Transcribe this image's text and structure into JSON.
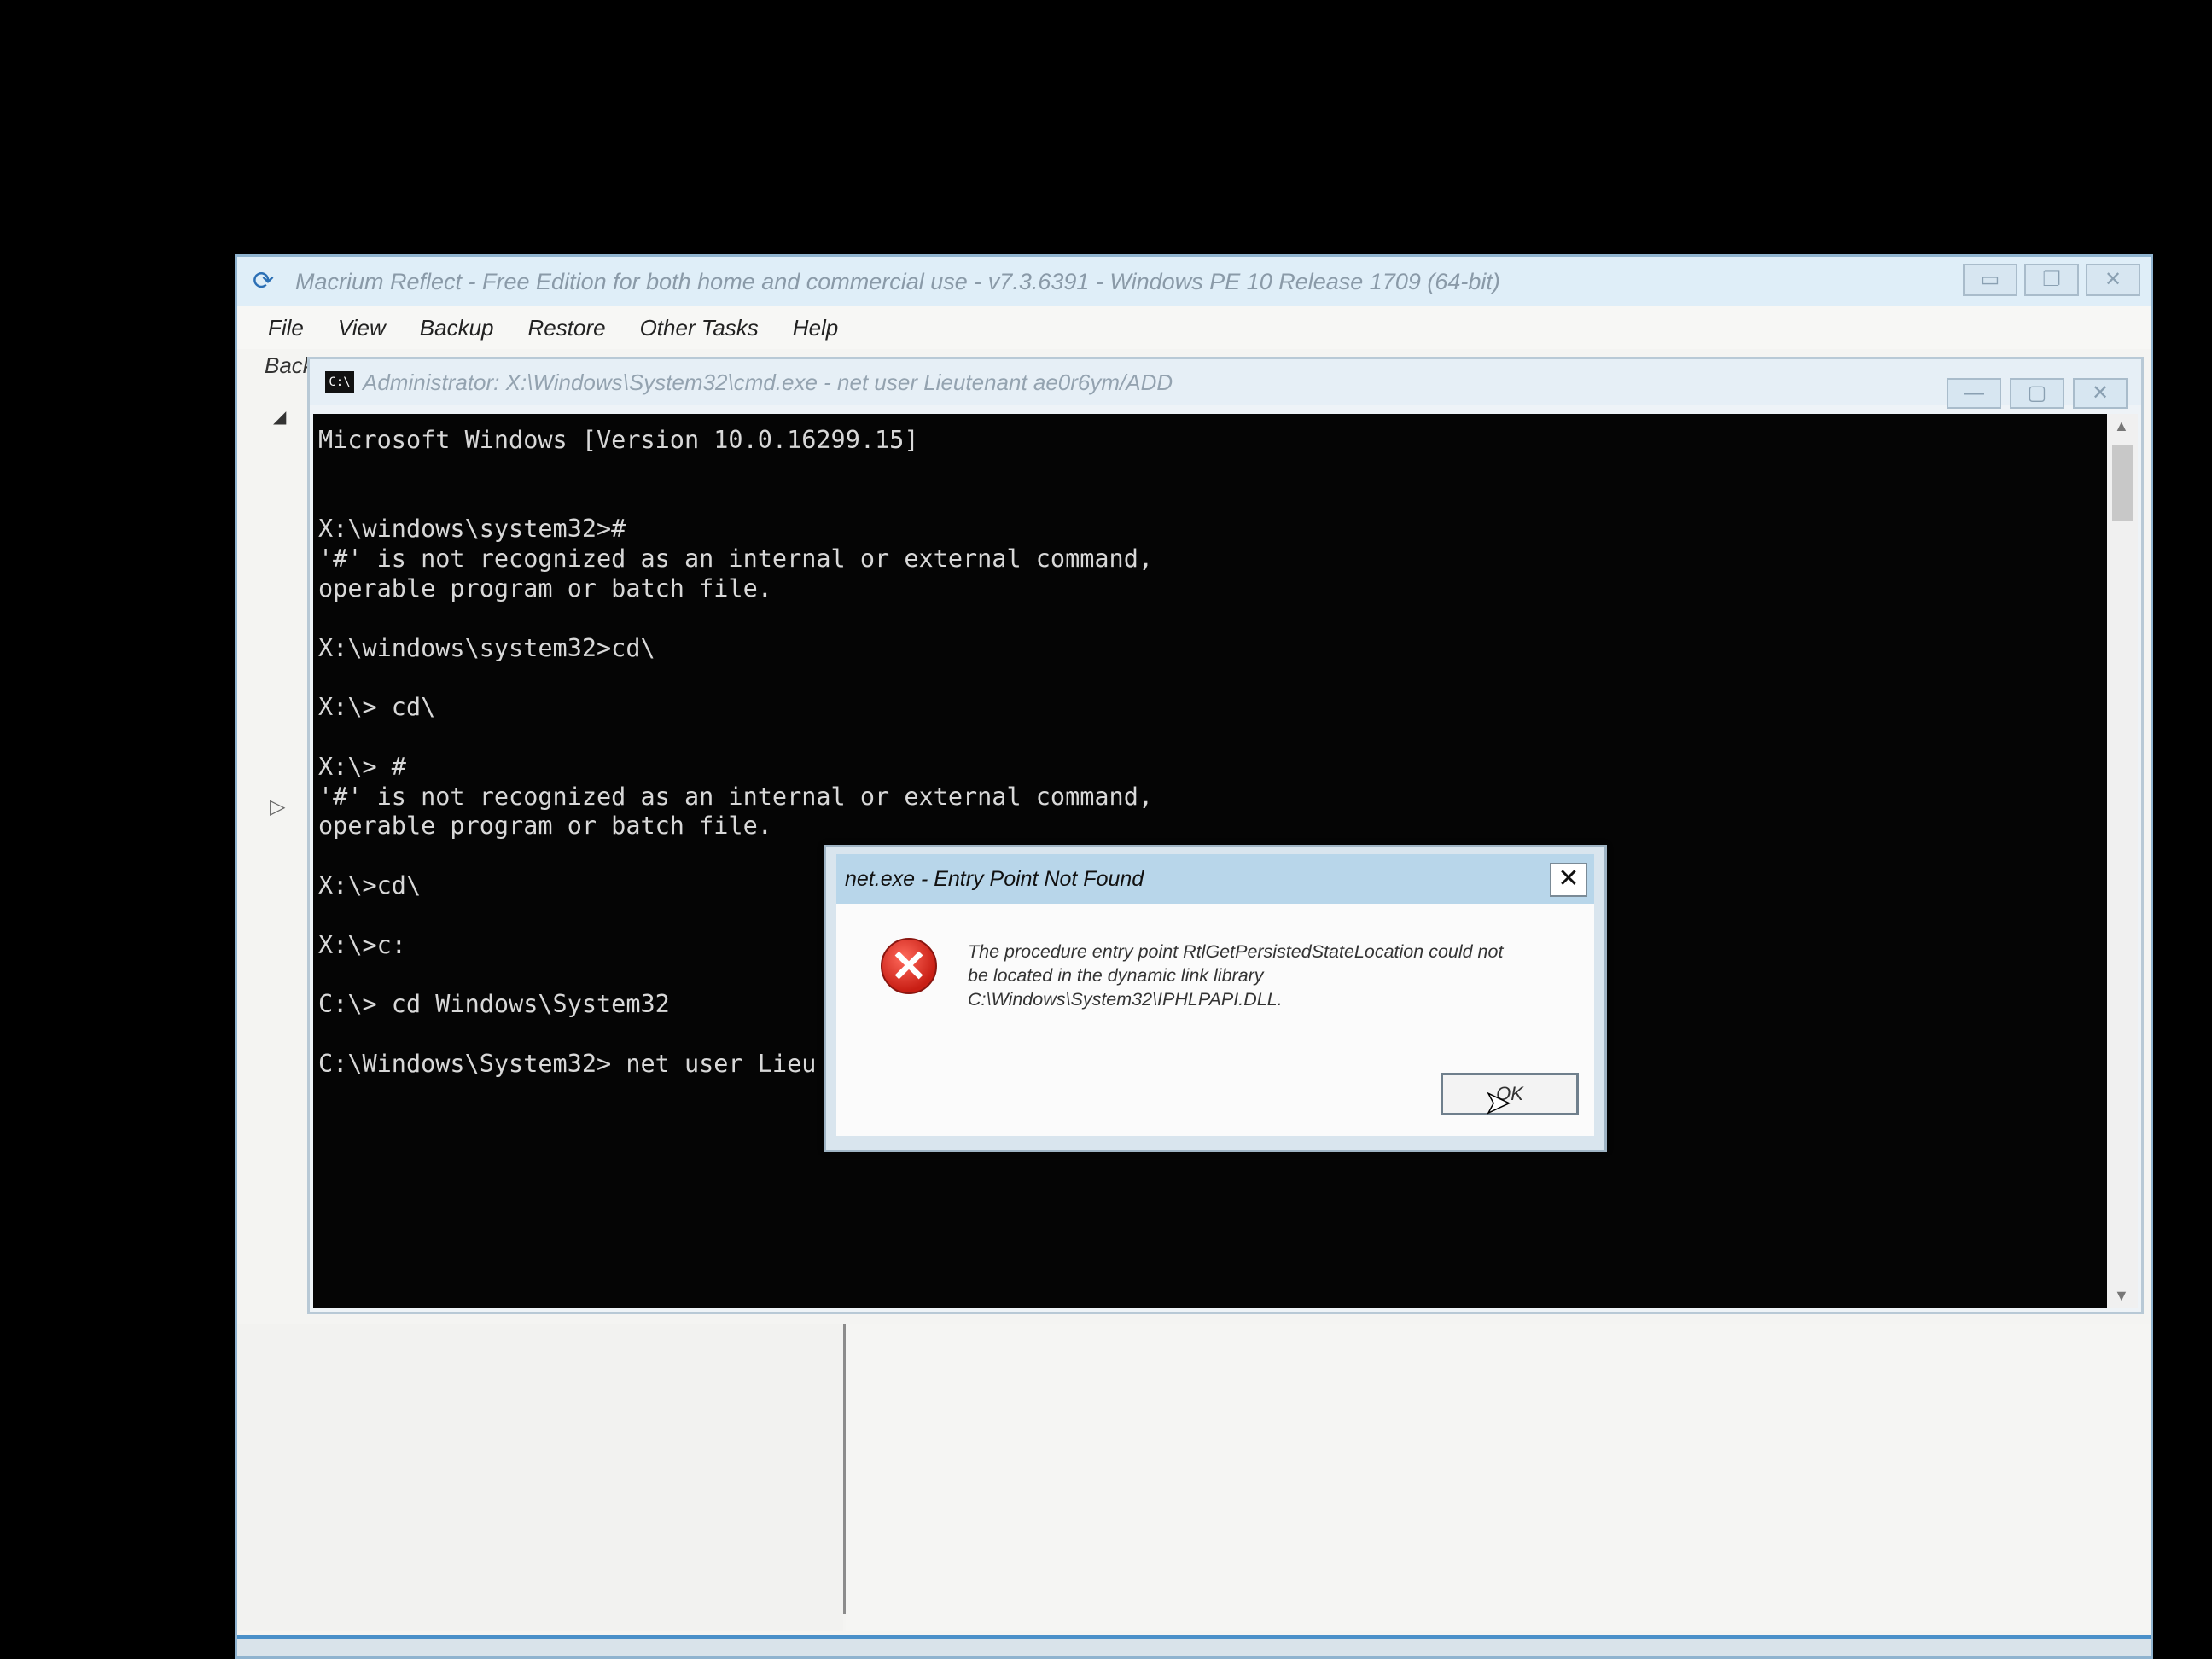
{
  "main_window": {
    "title": "Macrium Reflect - Free Edition for both home and commercial use - v7.3.6391 - Windows PE 10 Release 1709 (64-bit)",
    "menu": [
      "File",
      "View",
      "Backup",
      "Restore",
      "Other Tasks",
      "Help"
    ],
    "backup_label": "Back",
    "controls": {
      "minimize": "▭",
      "restore": "❐",
      "close": "✕"
    }
  },
  "cmd_window": {
    "title": "Administrator: X:\\Windows\\System32\\cmd.exe - net  user Lieutenant ae0r6ym/ADD",
    "icon_label": "C:\\",
    "controls": {
      "minimize": "—",
      "maximize": "▢",
      "close": "✕"
    },
    "lines": [
      "Microsoft Windows [Version 10.0.16299.15]",
      "",
      "",
      "X:\\windows\\system32>#",
      "'#' is not recognized as an internal or external command,",
      "operable program or batch file.",
      "",
      "X:\\windows\\system32>cd\\",
      "",
      "X:\\> cd\\",
      "",
      "X:\\> #",
      "'#' is not recognized as an internal or external command,",
      "operable program or batch file.",
      "",
      "X:\\>cd\\",
      "",
      "X:\\>c:",
      "",
      "C:\\> cd Windows\\System32",
      "",
      "C:\\Windows\\System32> net user Lieu"
    ]
  },
  "dialog": {
    "title": "net.exe - Entry Point Not Found",
    "close": "✕",
    "message_lines": [
      "The procedure entry point RtlGetPersistedStateLocation could not",
      "be located in the dynamic link library",
      "C:\\Windows\\System32\\IPHLPAPI.DLL."
    ],
    "ok_label": "OK",
    "error_glyph": "✕"
  }
}
